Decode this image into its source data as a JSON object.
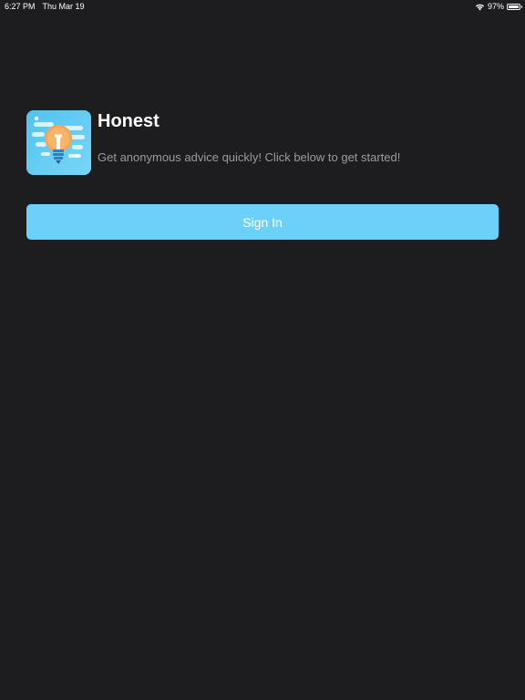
{
  "status_bar": {
    "time": "6:27 PM",
    "date": "Thu Mar 19",
    "battery_percent": "97%",
    "battery_level": 0.97,
    "wifi_icon": "wifi-icon",
    "battery_icon": "battery-icon"
  },
  "app": {
    "title": "Honest",
    "subtitle": "Get anonymous advice quickly! Click below to get started!",
    "icon": "lightbulb-icon"
  },
  "actions": {
    "sign_in_label": "Sign In"
  },
  "colors": {
    "background": "#1d1d1f",
    "accent": "#6dd0fb",
    "icon_background": "#5ac8f0",
    "bulb": "#f5a55a",
    "subtitle_text": "#9a9aa0"
  }
}
